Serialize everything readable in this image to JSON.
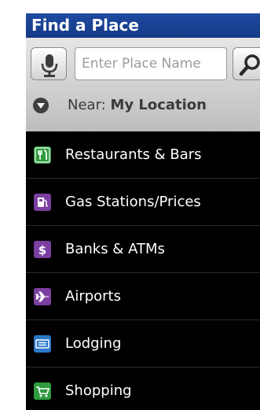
{
  "header": {
    "title": "Find a Place"
  },
  "search": {
    "placeholder": "Enter Place Name"
  },
  "near": {
    "label": "Near: ",
    "value": "My Location"
  },
  "categories": [
    {
      "label": "Restaurants & Bars",
      "icon": "restaurant-icon",
      "color": "#2e9b3e"
    },
    {
      "label": "Gas Stations/Prices",
      "icon": "gas-pump-icon",
      "color": "#7a3fa0"
    },
    {
      "label": "Banks & ATMs",
      "icon": "dollar-icon",
      "color": "#7a3fa0"
    },
    {
      "label": "Airports",
      "icon": "airplane-icon",
      "color": "#7a3fa0"
    },
    {
      "label": "Lodging",
      "icon": "bed-icon",
      "color": "#2a78c8"
    },
    {
      "label": "Shopping",
      "icon": "shopping-cart-icon",
      "color": "#2e9b3e"
    }
  ],
  "colors": {
    "title_bar": "#1a4394",
    "list_background": "#000000",
    "panel_background": "#d6d6d6"
  }
}
